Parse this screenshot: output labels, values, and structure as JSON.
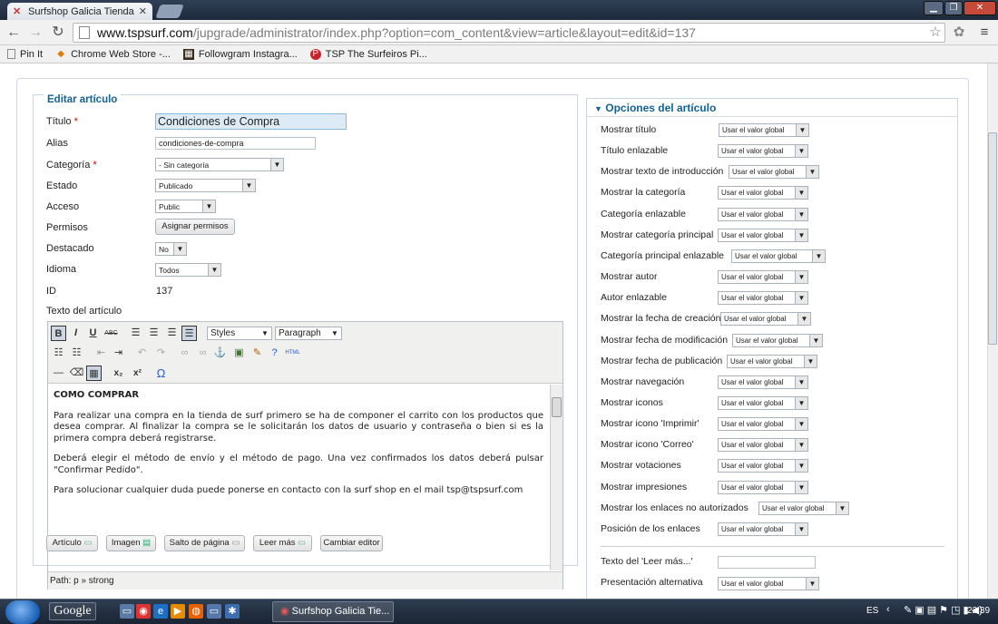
{
  "browser": {
    "tab_title": "Surfshop Galicia Tienda c",
    "url_host": "www.tspsurf.com",
    "url_path": "/jupgrade/administrator/index.php?option=com_content&view=article&layout=edit&id=137",
    "bookmarks": [
      {
        "label": "Pin It",
        "icon": "page-icon"
      },
      {
        "label": "Chrome Web Store -...",
        "icon": "chrome-store-icon"
      },
      {
        "label": "Followgram Instagra...",
        "icon": "followgram-icon"
      },
      {
        "label": "TSP The Surfeiros Pi...",
        "icon": "pinterest-icon"
      }
    ]
  },
  "edit": {
    "legend": "Editar artículo",
    "titulo_label": "Título",
    "titulo_value": "Condiciones de Compra",
    "alias_label": "Alias",
    "alias_value": "condiciones-de-compra",
    "categoria_label": "Categoría",
    "categoria_value": "- Sin categoría",
    "estado_label": "Estado",
    "estado_value": "Publicado",
    "acceso_label": "Acceso",
    "acceso_value": "Public",
    "permisos_label": "Permisos",
    "permisos_button": "Asignar permisos",
    "destacado_label": "Destacado",
    "destacado_value": "No",
    "idioma_label": "Idioma",
    "idioma_value": "Todos",
    "id_label": "ID",
    "id_value": "137",
    "texto_label": "Texto del artículo",
    "required_mark": "*"
  },
  "editor": {
    "styles_select": "Styles",
    "paragraph_select": "Paragraph",
    "heading": "COMO COMPRAR",
    "p1": "Para realizar una compra en la tienda de surf primero se ha de componer el carrito con los productos que desea comprar. Al finalizar la compra se le solicitarán los datos de usuario y contraseña o bien si es la primera compra deberá registrarse.",
    "p2": "Deberá elegir el método de envío y el método de pago. Una vez confirmados los datos deberá pulsar \"Confirmar Pedido\".",
    "p3": "Para solucionar cualquier duda puede ponerse en contacto con la surf shop en el mail tsp@tspsurf.com",
    "path": "Path: p » strong",
    "buttons": [
      "Artículo",
      "Imagen",
      "Salto de página",
      "Leer más",
      "Cambiar editor"
    ]
  },
  "options": {
    "title": "Opciones del artículo",
    "select_value": "Usar el valor global",
    "rows": [
      "Mostrar título",
      "Título enlazable",
      "Mostrar texto de introducción",
      "Mostrar la categoría",
      "Categoría enlazable",
      "Mostrar categoría principal",
      "Categoría principal enlazable",
      "Mostrar autor",
      "Autor enlazable",
      "Mostrar la fecha de creación",
      "Mostrar fecha de modificación",
      "Mostrar fecha de publicación",
      "Mostrar navegación",
      "Mostrar iconos",
      "Mostrar icono 'Imprimir'",
      "Mostrar icono 'Correo'",
      "Mostrar votaciones",
      "Mostrar impresiones",
      "Mostrar los enlaces no autorizados",
      "Posición de los enlaces"
    ],
    "leer_mas_label": "Texto del 'Leer más...'",
    "presentacion_label": "Presentación alternativa"
  },
  "taskbar": {
    "google_label": "Google",
    "app_label": "Surfshop Galicia Tie...",
    "lang": "ES",
    "time": "22:39"
  }
}
